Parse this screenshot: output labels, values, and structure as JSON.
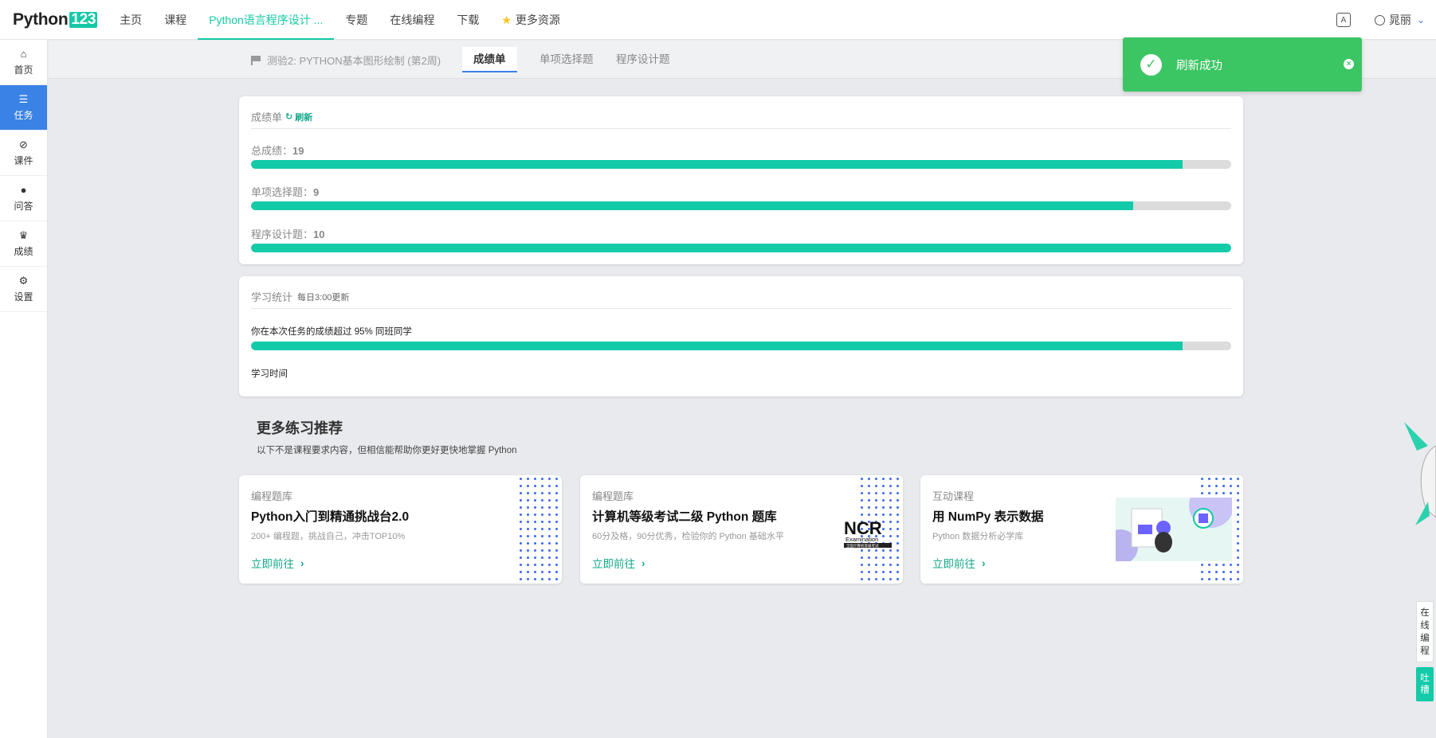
{
  "app": {
    "logo_text": "Python",
    "logo_num": "123",
    "nav": [
      {
        "label": "主页"
      },
      {
        "label": "课程"
      },
      {
        "label": "Python语言程序设计 ..."
      },
      {
        "label": "专题"
      },
      {
        "label": "在线编程"
      },
      {
        "label": "下载"
      },
      {
        "label": "更多资源"
      }
    ],
    "user_name": "晁丽"
  },
  "sidebar": {
    "items": [
      {
        "label": "首页",
        "icon": "home-icon"
      },
      {
        "label": "任务",
        "icon": "tasks-icon"
      },
      {
        "label": "课件",
        "icon": "paperclip-icon"
      },
      {
        "label": "问答",
        "icon": "comments-icon"
      },
      {
        "label": "成绩",
        "icon": "trophy-icon"
      },
      {
        "label": "设置",
        "icon": "gear-icon"
      }
    ],
    "active_index": 1
  },
  "subheader": {
    "crumb": "测验2: PYTHON基本图形绘制 (第2周)",
    "tabs": [
      "成绩单",
      "单项选择题",
      "程序设计题"
    ],
    "active_tab": 0
  },
  "scores": {
    "title": "成绩单",
    "refresh_label": "刷新",
    "items": [
      {
        "label": "总成绩：",
        "value": "19",
        "fraction": 0.95
      },
      {
        "label": "单项选择题：",
        "value": "9",
        "fraction": 0.9
      },
      {
        "label": "程序设计题：",
        "value": "10",
        "fraction": 1.0
      }
    ]
  },
  "stats": {
    "title": "学习统计",
    "subtitle": "每日3:00更新",
    "exceed_text": "你在本次任务的成绩超过 95% 同班同学",
    "exceed_fraction": 0.95,
    "time_label": "学习时间"
  },
  "more": {
    "title": "更多练习推荐",
    "subtitle": "以下不是课程要求内容，但相信能帮助你更好更快地掌握 Python",
    "cards": [
      {
        "category": "编程题库",
        "title": "Python入门到精通挑战台2.0",
        "desc": "200+ 编程题，挑战自己，冲击TOP10%",
        "link": "立即前往"
      },
      {
        "category": "编程题库",
        "title": "计算机等级考试二级 Python 题库",
        "desc": "60分及格，90分优秀，检验你的 Python 基础水平",
        "link": "立即前往",
        "logo_text": "NCR",
        "logo_sub": "Examination",
        "logo_caption": "全国计算机等级考试"
      },
      {
        "category": "互动课程",
        "title": "用 NumPy 表示数据",
        "desc": "Python 数据分析必学库",
        "link": "立即前往"
      }
    ]
  },
  "toast": {
    "message": "刷新成功",
    "color": "#3cc563"
  },
  "floating": {
    "code": [
      "在",
      "线",
      "编",
      "程"
    ],
    "feedback": [
      "吐",
      "槽"
    ]
  },
  "colors": {
    "accent": "#14c9a6",
    "progress": "#13cba8",
    "sidebar_active": "#3a82e6"
  }
}
